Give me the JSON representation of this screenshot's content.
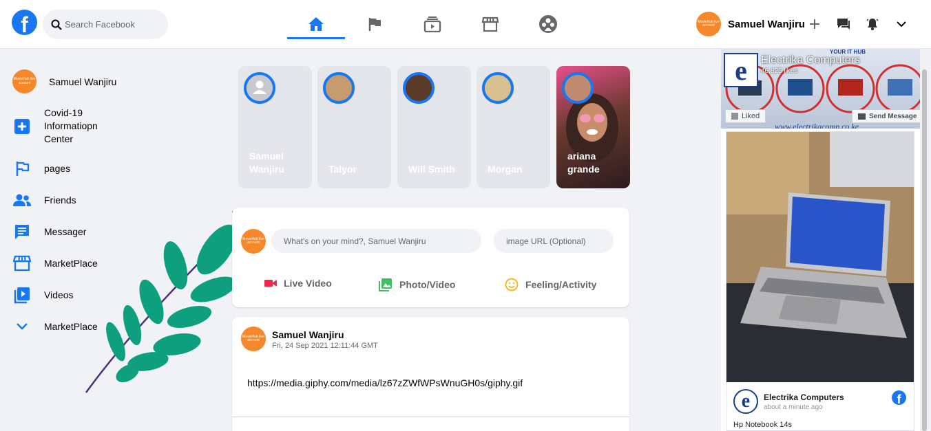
{
  "header": {
    "logo_letter": "f",
    "search_placeholder": "Search Facebook",
    "user_name": "Samuel Wanjiru",
    "avatar_text": "MovieHub live account"
  },
  "sidebar": {
    "profile_name": "Samuel Wanjiru",
    "items": [
      {
        "label": "Covid-19 Informatiopn Center",
        "icon": "plus-icon"
      },
      {
        "label": "pages",
        "icon": "flag-icon"
      },
      {
        "label": "Friends",
        "icon": "friends-icon"
      },
      {
        "label": "Messager",
        "icon": "message-icon"
      },
      {
        "label": "MarketPlace",
        "icon": "store-icon"
      },
      {
        "label": "Videos",
        "icon": "video-icon"
      },
      {
        "label": "MarketPlace",
        "icon": "chevron-down-icon"
      }
    ]
  },
  "stories": [
    {
      "name": "Samuel Wanjiru"
    },
    {
      "name": "Talyor"
    },
    {
      "name": "Will Smith"
    },
    {
      "name": "Morgan"
    },
    {
      "name": "ariana grande"
    }
  ],
  "composer": {
    "stray_char": "\\",
    "post_placeholder": "What's on your mind?, Samuel Wanjiru",
    "image_placeholder": "image URL (Optional)",
    "actions": {
      "live": "Live Video",
      "photo": "Photo/Video",
      "feeling": "Feeling/Activity"
    }
  },
  "post": {
    "author": "Samuel Wanjiru",
    "timestamp": "Fri, 24 Sep 2021 12:11:44 GMT",
    "body": "https://media.giphy.com/media/lz67zZWfWPsWnuGH0s/giphy.gif"
  },
  "widget": {
    "page_name": "Electrika Computers",
    "likes": "46,825 likes",
    "liked_label": "Liked",
    "send_message_label": "Send Message",
    "banner_url": "www.electrikacomp.co.ke",
    "banner_tag": "YOUR IT HUB",
    "post_page_name": "Electrika Computers",
    "post_time": "about a minute ago",
    "post_text_partial": "Hp Notebook 14s"
  },
  "colors": {
    "brand": "#1877f2",
    "background": "#f0f2f5",
    "avatar": "#f5882a",
    "live": "#f02849",
    "photo": "#45bd62",
    "feeling": "#f7b928",
    "leaf": "#0e9f7f"
  }
}
